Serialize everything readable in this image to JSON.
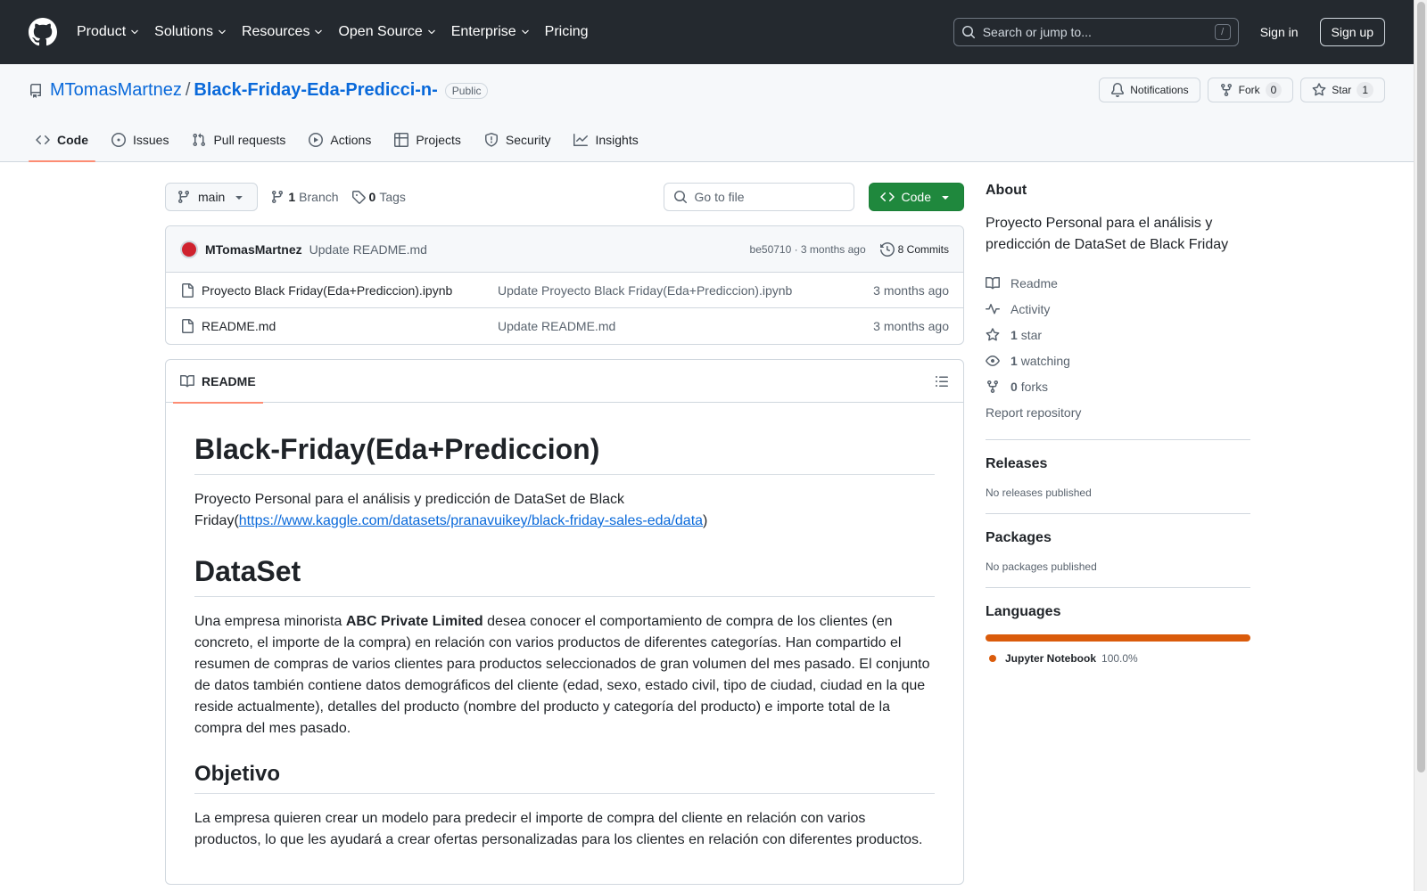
{
  "header": {
    "nav": [
      "Product",
      "Solutions",
      "Resources",
      "Open Source",
      "Enterprise",
      "Pricing"
    ],
    "search_placeholder": "Search or jump to...",
    "search_shortcut": "/",
    "signin": "Sign in",
    "signup": "Sign up"
  },
  "repo": {
    "owner": "MTomasMartnez",
    "separator": "/",
    "name": "Black-Friday-Eda-Predicci-n-",
    "visibility": "Public",
    "notifications_label": "Notifications",
    "fork_label": "Fork",
    "fork_count": "0",
    "star_label": "Star",
    "star_count": "1"
  },
  "tabs": [
    "Code",
    "Issues",
    "Pull requests",
    "Actions",
    "Projects",
    "Security",
    "Insights"
  ],
  "toolbar": {
    "branch": "main",
    "branch_count": "1",
    "branch_label": "Branch",
    "tag_count": "0",
    "tag_label": "Tags",
    "goto_placeholder": "Go to file",
    "code_button": "Code"
  },
  "commit": {
    "author": "MTomasMartnez",
    "message": "Update README.md",
    "hash_age": "be50710 · 3 months ago",
    "commits_label": "8 Commits"
  },
  "files": [
    {
      "name": "Proyecto Black Friday(Eda+Prediccion).ipynb",
      "message": "Update Proyecto Black Friday(Eda+Prediccion).ipynb",
      "age": "3 months ago"
    },
    {
      "name": "README.md",
      "message": "Update README.md",
      "age": "3 months ago"
    }
  ],
  "readme": {
    "tab_label": "README",
    "h1": "Black-Friday(Eda+Prediccion)",
    "intro_text": "Proyecto Personal para el análisis y predicción de DataSet de Black Friday(",
    "intro_link": "https://www.kaggle.com/datasets/pranavuikey/black-friday-sales-eda/data",
    "intro_close": ")",
    "h_dataset": "DataSet",
    "dataset_pre": "Una empresa minorista ",
    "dataset_bold": "ABC Private Limited",
    "dataset_post": " desea conocer el comportamiento de compra de los clientes (en concreto, el importe de la compra) en relación con varios productos de diferentes categorías. Han compartido el resumen de compras de varios clientes para productos seleccionados de gran volumen del mes pasado. El conjunto de datos también contiene datos demográficos del cliente (edad, sexo, estado civil, tipo de ciudad, ciudad en la que reside actualmente), detalles del producto (nombre del producto y categoría del producto) e importe total de la compra del mes pasado.",
    "h_objetivo": "Objetivo",
    "objetivo_text": "La empresa quieren crear un modelo para predecir el importe de compra del cliente en relación con varios productos, lo que les ayudará a crear ofertas personalizadas para los clientes en relación con diferentes productos."
  },
  "sidebar": {
    "about_title": "About",
    "about_desc": "Proyecto Personal para el análisis y predicción de DataSet de Black Friday",
    "readme": "Readme",
    "activity": "Activity",
    "stars_count": "1",
    "stars_label": "star",
    "watching_count": "1",
    "watching_label": "watching",
    "forks_count": "0",
    "forks_label": "forks",
    "report": "Report repository",
    "releases_title": "Releases",
    "releases_empty": "No releases published",
    "packages_title": "Packages",
    "packages_empty": "No packages published",
    "languages_title": "Languages",
    "language_name": "Jupyter Notebook",
    "language_pct": "100.0%",
    "language_color": "#da5b0b"
  }
}
